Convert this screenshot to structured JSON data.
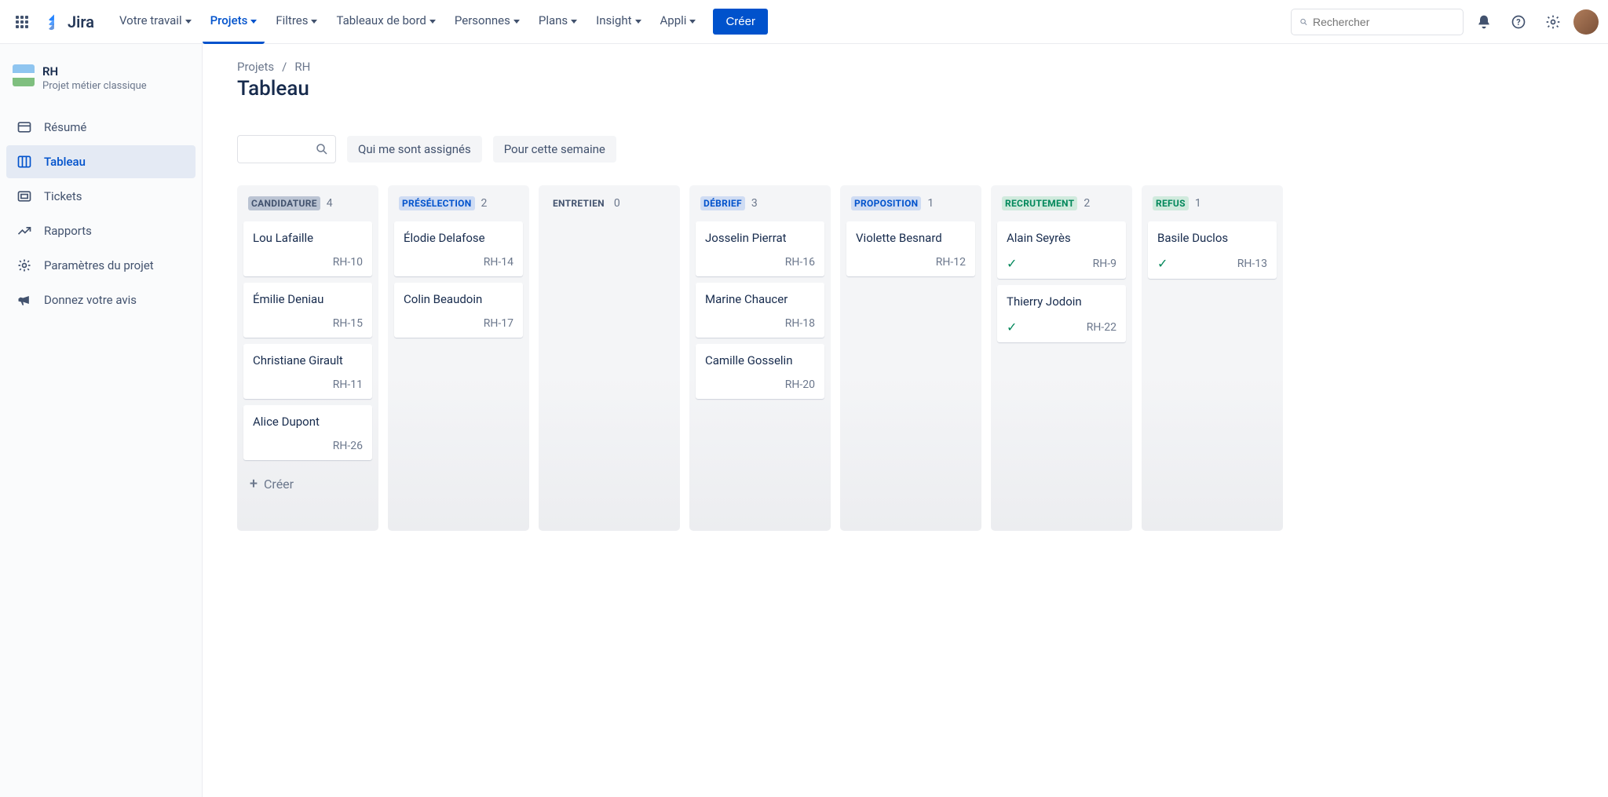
{
  "appName": "Jira",
  "nav": {
    "items": [
      {
        "label": "Votre travail"
      },
      {
        "label": "Projets"
      },
      {
        "label": "Filtres"
      },
      {
        "label": "Tableaux de bord"
      },
      {
        "label": "Personnes"
      },
      {
        "label": "Plans"
      },
      {
        "label": "Insight"
      },
      {
        "label": "Appli"
      }
    ],
    "create": "Créer",
    "searchPlaceholder": "Rechercher"
  },
  "sidebar": {
    "projectName": "RH",
    "projectType": "Projet métier classique",
    "items": [
      {
        "label": "Résumé",
        "icon": "card"
      },
      {
        "label": "Tableau",
        "icon": "board"
      },
      {
        "label": "Tickets",
        "icon": "ticket"
      },
      {
        "label": "Rapports",
        "icon": "chart"
      },
      {
        "label": "Paramètres du projet",
        "icon": "gear"
      },
      {
        "label": "Donnez votre avis",
        "icon": "megaphone"
      }
    ]
  },
  "breadcrumb": {
    "root": "Projets",
    "sep": "/",
    "leaf": "RH"
  },
  "pageTitle": "Tableau",
  "filters": {
    "assignedToMe": "Qui me sont assignés",
    "thisWeek": "Pour cette semaine"
  },
  "board": {
    "columns": [
      {
        "title": "CANDIDATURE",
        "count": 4,
        "cards": [
          {
            "name": "Lou Lafaille",
            "key": "RH-10"
          },
          {
            "name": "Émilie Deniau",
            "key": "RH-15"
          },
          {
            "name": "Christiane Girault",
            "key": "RH-11"
          },
          {
            "name": "Alice Dupont",
            "key": "RH-26"
          }
        ],
        "create": "Créer"
      },
      {
        "title": "PRÉSÉLECTION",
        "count": 2,
        "cards": [
          {
            "name": "Élodie Delafose",
            "key": "RH-14"
          },
          {
            "name": "Colin Beaudoin",
            "key": "RH-17"
          }
        ]
      },
      {
        "title": "ENTRETIEN",
        "count": 0,
        "cards": []
      },
      {
        "title": "DÉBRIEF",
        "count": 3,
        "cards": [
          {
            "name": "Josselin Pierrat",
            "key": "RH-16"
          },
          {
            "name": "Marine Chaucer",
            "key": "RH-18"
          },
          {
            "name": "Camille Gosselin",
            "key": "RH-20"
          }
        ]
      },
      {
        "title": "PROPOSITION",
        "count": 1,
        "cards": [
          {
            "name": "Violette Besnard",
            "key": "RH-12"
          }
        ]
      },
      {
        "title": "RECRUTEMENT",
        "count": 2,
        "cards": [
          {
            "name": "Alain Seyrès",
            "key": "RH-9",
            "done": true
          },
          {
            "name": "Thierry Jodoin",
            "key": "RH-22",
            "done": true
          }
        ]
      },
      {
        "title": "REFUS",
        "count": 1,
        "cards": [
          {
            "name": "Basile Duclos",
            "key": "RH-13",
            "done": true
          }
        ]
      }
    ]
  }
}
